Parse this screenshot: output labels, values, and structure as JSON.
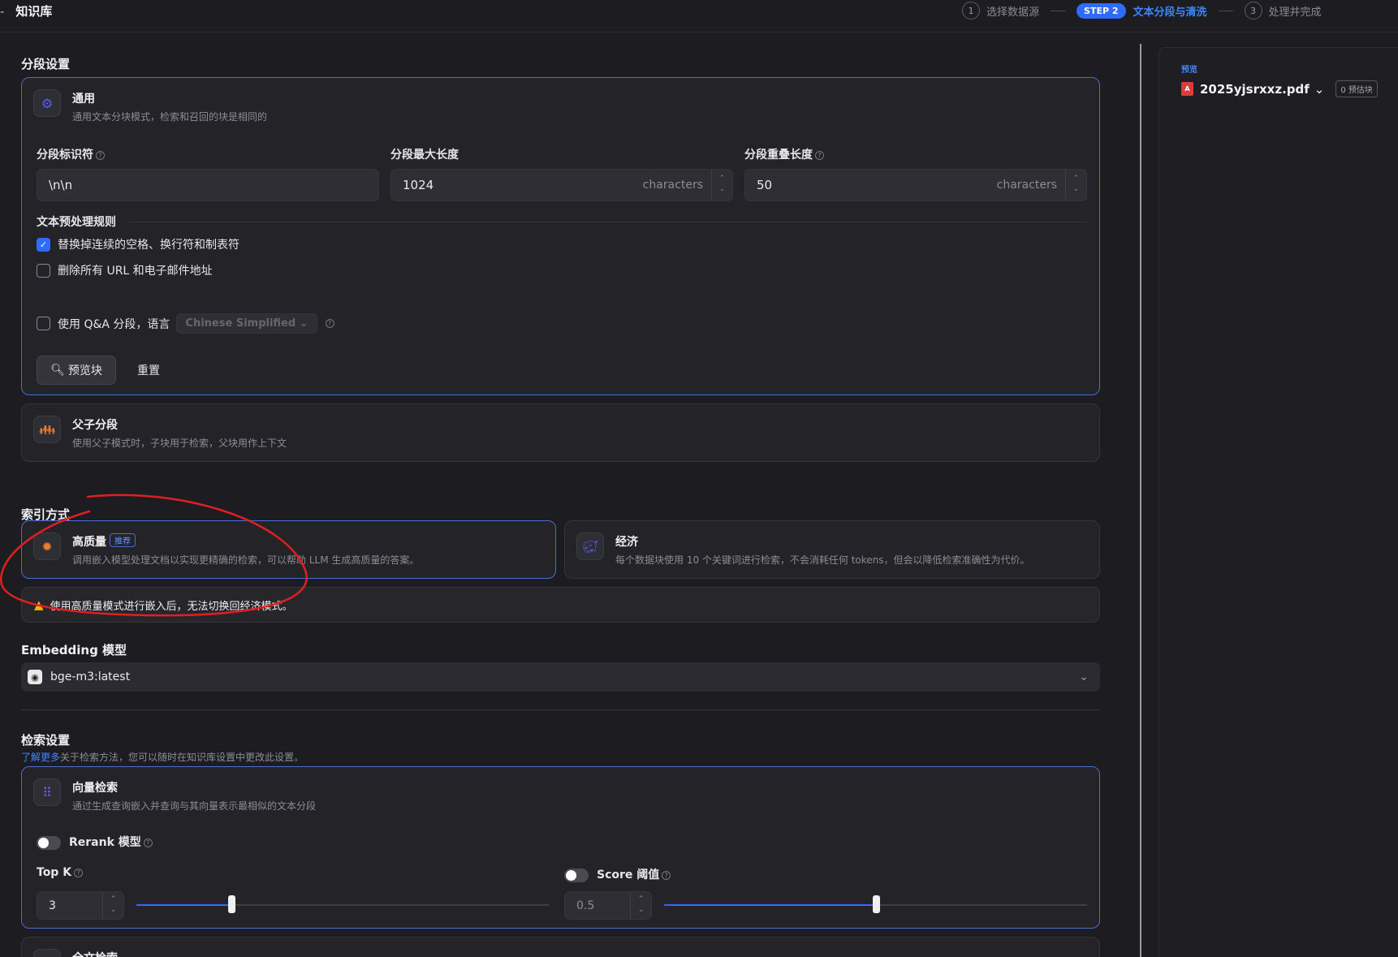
{
  "header": {
    "title": "知识库",
    "steps": [
      {
        "num": "1",
        "label": "选择数据源"
      },
      {
        "pill": "STEP 2",
        "label": "文本分段与清洗"
      },
      {
        "num": "3",
        "label": "处理并完成"
      }
    ]
  },
  "segment": {
    "section_title": "分段设置",
    "general": {
      "title": "通用",
      "desc": "通用文本分块模式，检索和召回的块是相同的",
      "separator_label": "分段标识符",
      "separator_value": "\\n\\n",
      "max_len_label": "分段最大长度",
      "max_len_value": "1024",
      "overlap_label": "分段重叠长度",
      "overlap_value": "50",
      "unit": "characters",
      "rules_label": "文本预处理规则",
      "rule1": "替换掉连续的空格、换行符和制表符",
      "rule2": "删除所有 URL 和电子邮件地址",
      "qa_label": "使用 Q&A 分段，语言",
      "qa_lang": "Chinese Simplified",
      "preview_btn": "预览块",
      "reset_btn": "重置"
    },
    "parent_child": {
      "title": "父子分段",
      "desc": "使用父子模式时，子块用于检索，父块用作上下文"
    }
  },
  "index": {
    "section_title": "索引方式",
    "high": {
      "title": "高质量",
      "badge": "推荐",
      "desc": "调用嵌入模型处理文档以实现更精确的检索，可以帮助 LLM 生成高质量的答案。"
    },
    "eco": {
      "title": "经济",
      "desc": "每个数据块使用 10 个关键词进行检索，不会消耗任何 tokens，但会以降低检索准确性为代价。"
    },
    "warning": "使用高质量模式进行嵌入后，无法切换回经济模式。"
  },
  "embedding": {
    "title": "Embedding 模型",
    "model": "bge-m3:latest"
  },
  "retrieval": {
    "title": "检索设置",
    "learn_more": "了解更多",
    "hint": "关于检索方法，您可以随时在知识库设置中更改此设置。",
    "vector": {
      "title": "向量检索",
      "desc": "通过生成查询嵌入并查询与其向量表示最相似的文本分段"
    },
    "rerank_label": "Rerank 模型",
    "topk_label": "Top K",
    "topk_value": "3",
    "topk_fraction": 0.23,
    "score_label": "Score 阈值",
    "score_value": "0.5",
    "score_fraction": 0.5,
    "fulltext_title": "全文检索"
  },
  "preview": {
    "label": "预览",
    "file": "2025yjsrxxz.pdf",
    "chunks": "0 预估块"
  },
  "colors": {
    "accent": "#2f6bff",
    "warning": "#f5b400",
    "annotation": "#e02020"
  }
}
